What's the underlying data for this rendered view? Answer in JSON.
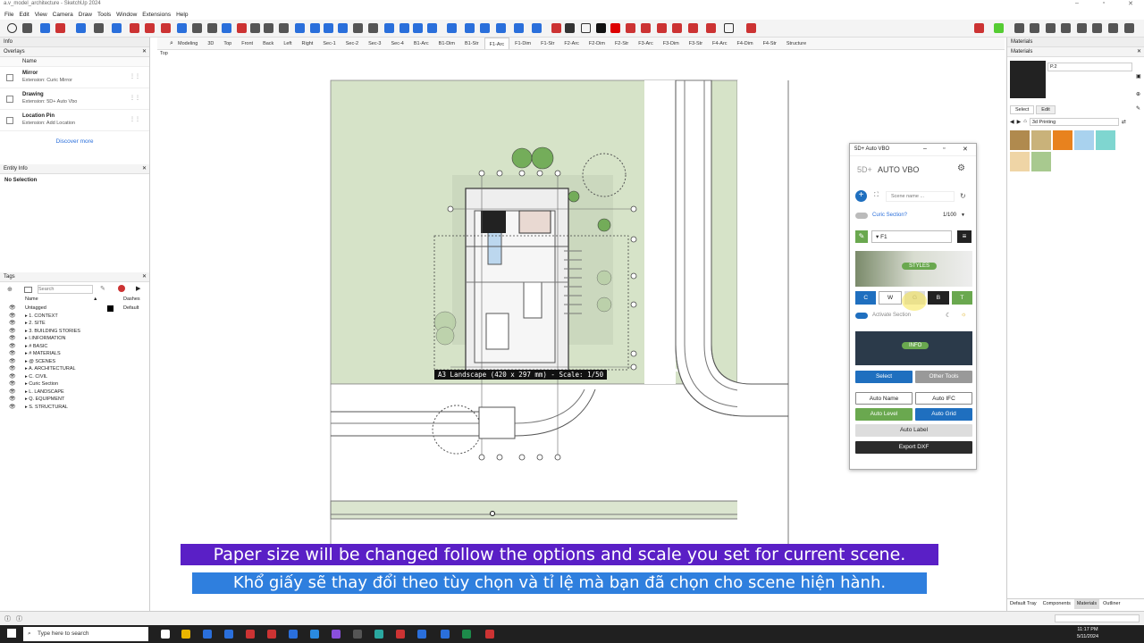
{
  "app": {
    "title": "a.v_model_architecture - SketchUp 2024"
  },
  "menu": [
    "File",
    "Edit",
    "View",
    "Camera",
    "Draw",
    "Tools",
    "Window",
    "Extensions",
    "Help"
  ],
  "left": {
    "info_title": "Info",
    "overlays_title": "Overlays",
    "overlays_col": "Name",
    "overlays": [
      {
        "name": "Mirror",
        "sub": "Extension: Curic Mirror"
      },
      {
        "name": "Drawing",
        "sub": "Extension: 5D+ Auto Vbo"
      },
      {
        "name": "Location Pin",
        "sub": "Extension: Add Location"
      }
    ],
    "discover": "Discover more",
    "entity_title": "Entity Info",
    "no_selection": "No Selection",
    "tags_title": "Tags",
    "tags_search": "Search",
    "tags_col_name": "Name",
    "tags_col_dashes": "Dashes",
    "untagged": "Untagged",
    "untagged_dash": "Default",
    "tags": [
      "1. CONTEXT",
      "2. SITE",
      "3. BUILDING STORIES",
      "I.INFORMATION",
      "# BASIC",
      "# MATERIALS",
      "@ SCENES",
      "A. ARCHITECTURAL",
      "C. CIVIL",
      "Curic Section",
      "L. LANDSCAPE",
      "Q. EQUIPMENT",
      "S. STRUCTURAL"
    ]
  },
  "view_label": "Top",
  "tabs": [
    "Modeling",
    "3D",
    "Top",
    "Front",
    "Back",
    "Left",
    "Right",
    "Sec-1",
    "Sec-2",
    "Sec-3",
    "Sec-4",
    "B1-Arc",
    "B1-Dim",
    "B1-Str",
    "F1-Arc",
    "F1-Dim",
    "F1-Str",
    "F2-Arc",
    "F2-Dim",
    "F2-Str",
    "F3-Arc",
    "F3-Dim",
    "F3-Str",
    "F4-Arc",
    "F4-Dim",
    "F4-Str",
    "Structure"
  ],
  "active_tab": "F1-Arc",
  "paper_label": "A3 Landscape (420 x 297 mm) - Scale: 1/50",
  "right": {
    "title": "Materials",
    "sub": "Materials",
    "mat_name": "P.2",
    "tab_select": "Select",
    "tab_edit": "Edit",
    "library": "3d Printing",
    "swatches": [
      "#b08a4e",
      "#c9b27a",
      "#e8821e",
      "#a9d2ee",
      "#7fd6d0",
      "#efd5a6",
      "#a8c98f"
    ]
  },
  "plugin": {
    "win_title": "5D+ Auto VBO",
    "brand": "5D+",
    "name": "AUTO VBO",
    "scene_placeholder": "Scene name ...",
    "curic_label": "Curic Section?",
    "scale": "1/100",
    "level_value": "F1",
    "styles": "STYLES",
    "style_btns": [
      "C",
      "W",
      "G",
      "B",
      "T"
    ],
    "activate": "Activate Section",
    "info": "INFO",
    "select": "Select",
    "other_tools": "Other Tools",
    "auto_name": "Auto Name",
    "auto_ifc": "Auto IFC",
    "auto_level": "Auto Level",
    "auto_grid": "Auto Grid",
    "auto_label": "Auto Label",
    "export_dxf": "Export DXF"
  },
  "subtitles": {
    "en": "Paper size will be changed follow the options and scale you set for current scene.",
    "vi": "Khổ giấy sẽ thay đổi theo tùy chọn và tỉ lệ mà bạn đã chọn cho scene hiện hành."
  },
  "bottom_tabs": [
    "Default Tray",
    "Components",
    "Materials",
    "Outliner"
  ],
  "taskbar": {
    "search": "Type here to search",
    "time": "11:17 PM",
    "date": "5/11/2024"
  }
}
